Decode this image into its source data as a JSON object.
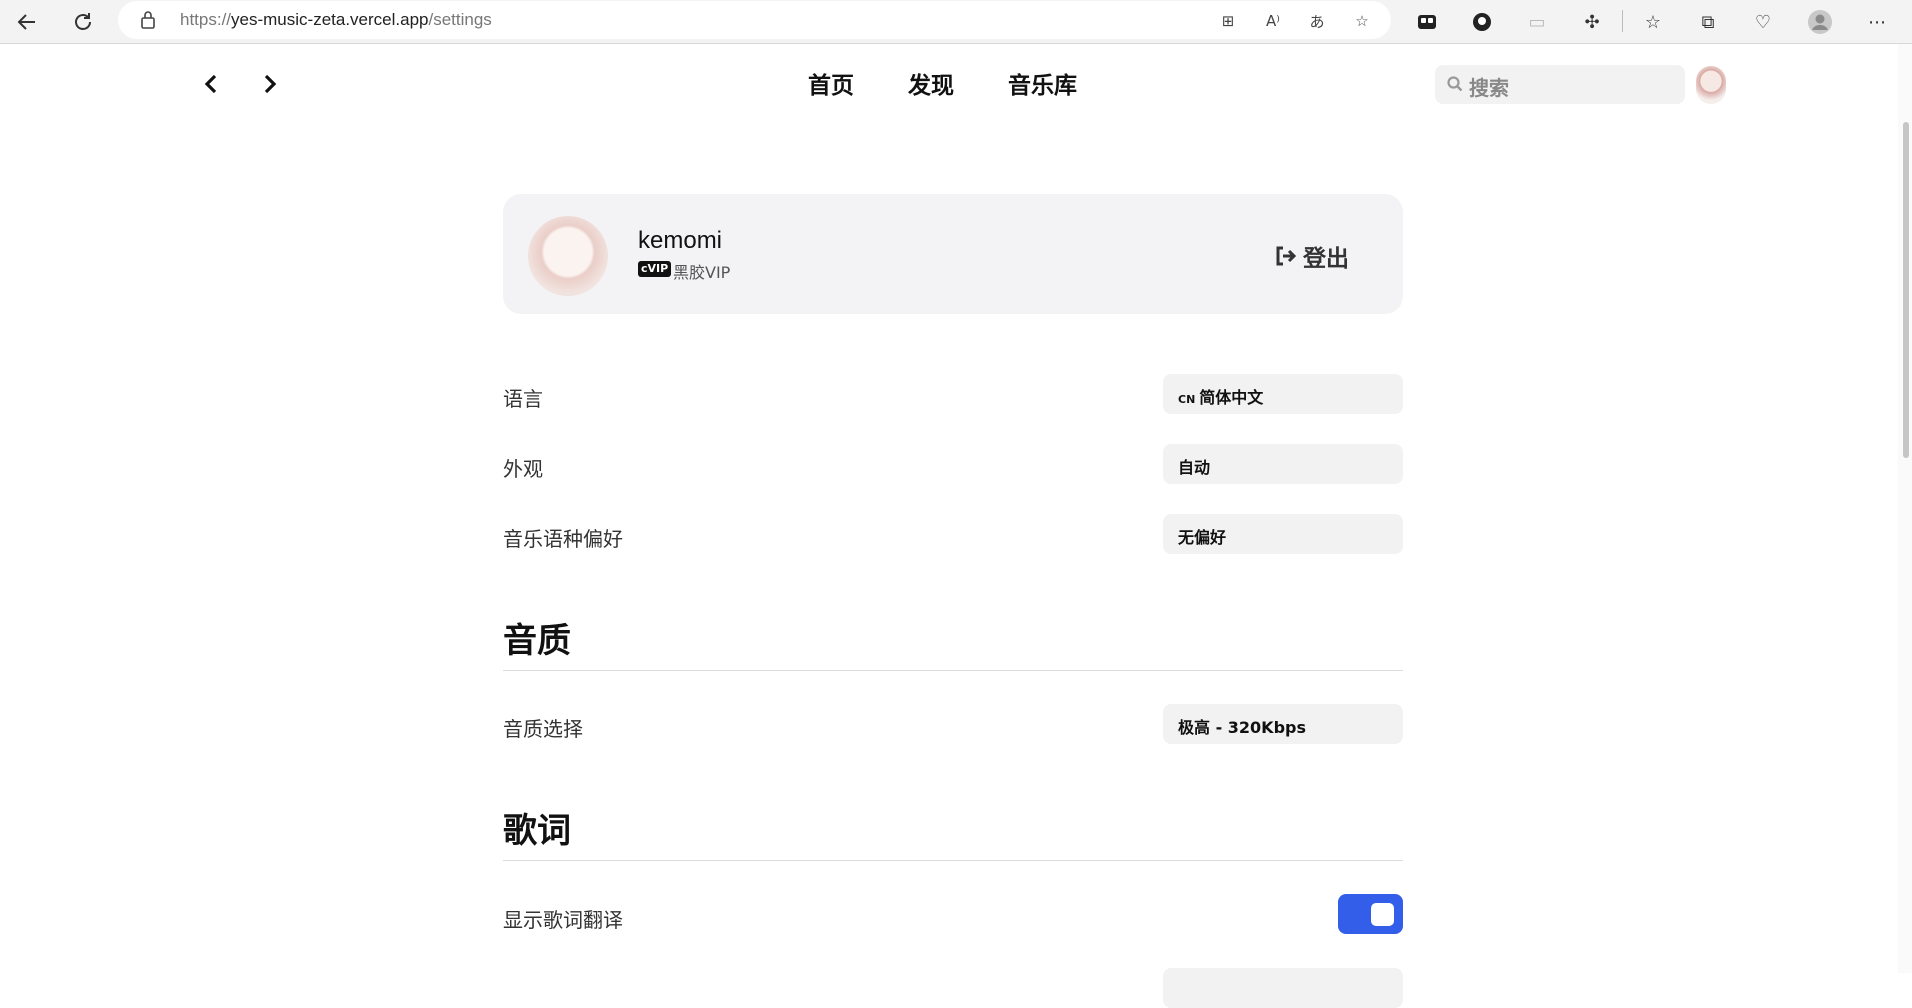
{
  "browser": {
    "url_scheme": "https://",
    "url_host": "yes-music-zeta.vercel.app",
    "url_path": "/settings"
  },
  "nav": {
    "links": [
      "首页",
      "发现",
      "音乐库"
    ],
    "search_placeholder": "搜索"
  },
  "user": {
    "name": "kemomi",
    "vip_badge": "cVIP",
    "vip_name": "黑胶VIP",
    "logout_label": "登出"
  },
  "settings": {
    "language": {
      "label": "语言",
      "flag": "CN",
      "value": "简体中文"
    },
    "appearance": {
      "label": "外观",
      "value": "自动"
    },
    "music_language": {
      "label": "音乐语种偏好",
      "value": "无偏好"
    }
  },
  "sections": {
    "quality": {
      "title": "音质",
      "select_label": "音质选择",
      "select_value": "极高 - 320Kbps"
    },
    "lyrics": {
      "title": "歌词",
      "translation_label": "显示歌词翻译",
      "translation_on": true
    }
  },
  "colors": {
    "accent": "#335eea",
    "card_bg": "#f3f3f5",
    "select_bg": "#f2f2f3"
  }
}
